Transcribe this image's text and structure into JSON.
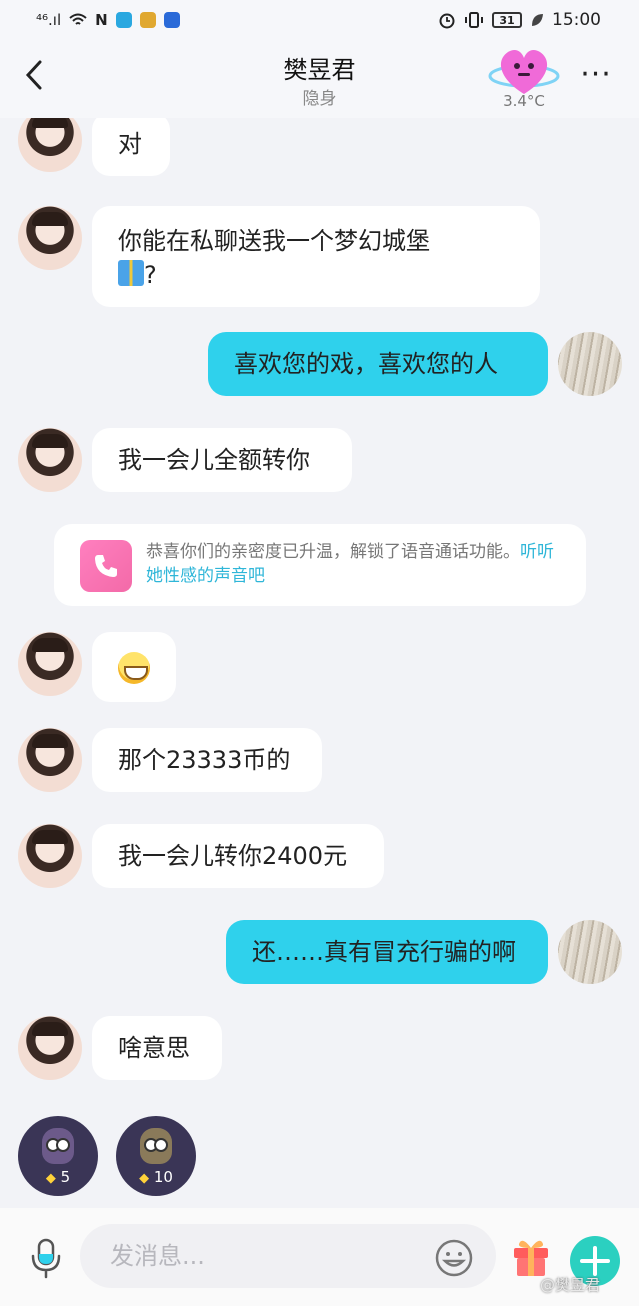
{
  "status_bar": {
    "signal": "⁴⁶.ıl",
    "time": "15:00",
    "battery": "31"
  },
  "header": {
    "title": "樊昱君",
    "subtitle": "隐身",
    "temperature": "3.4°C",
    "more": "···"
  },
  "messages": [
    {
      "from": "her",
      "text": "对"
    },
    {
      "from": "her",
      "text_line1": "你能在私聊送我一个梦幻城堡",
      "text_line2": "?"
    },
    {
      "from": "me",
      "text": "喜欢您的戏，喜欢您的人"
    },
    {
      "from": "her",
      "text": "我一会儿全额转你"
    },
    {
      "from": "her",
      "text": ""
    },
    {
      "from": "her",
      "text": "那个23333币的"
    },
    {
      "from": "her",
      "text": "我一会儿转你2400元"
    },
    {
      "from": "me",
      "text": "还……真有冒充行骗的啊"
    },
    {
      "from": "her",
      "text": "啥意思"
    }
  ],
  "system_notice": {
    "text": "恭喜你们的亲密度已升温，解锁了语音通话功能。",
    "link": "听听她性感的声音吧"
  },
  "gift_stickers": [
    {
      "icon": "owl-gift-icon",
      "price": "5"
    },
    {
      "icon": "owl-angel-gift-icon",
      "price": "10"
    }
  ],
  "input_bar": {
    "placeholder": "发消息..."
  },
  "watermark": "@樊昱君",
  "colors": {
    "my_bubble": "#2fd1ec",
    "her_bubble": "#ffffff",
    "background": "#f2f3f7",
    "plus_button": "#2bd0c0",
    "link": "#2fb6d8"
  }
}
